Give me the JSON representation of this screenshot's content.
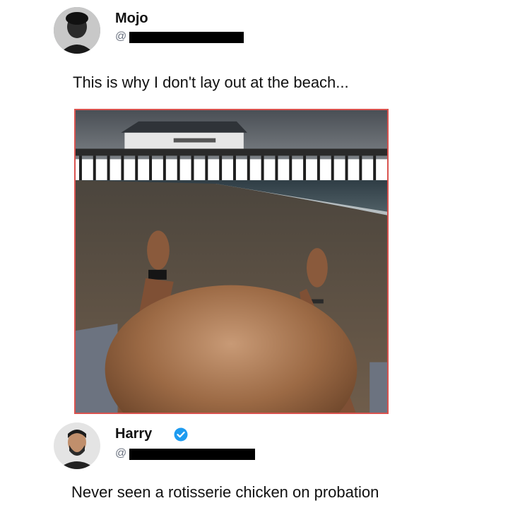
{
  "posts": [
    {
      "display_name": "Mojo",
      "handle_prefix": "@",
      "text": "This is why I don't lay out at the beach...",
      "verified": false,
      "avatar_icon": "user-avatar-photo",
      "media": {
        "icon": "beach-photo-image"
      }
    },
    {
      "display_name": "Harry",
      "handle_prefix": "@",
      "text": "Never seen a rotisserie chicken on probation",
      "verified": true,
      "verified_icon": "verified-badge-icon",
      "avatar_icon": "user-avatar-photo"
    }
  ],
  "colors": {
    "verified_blue": "#1d9bf0",
    "handle_gray": "#6b7280",
    "media_border": "#d9534f",
    "redaction": "#000000"
  }
}
